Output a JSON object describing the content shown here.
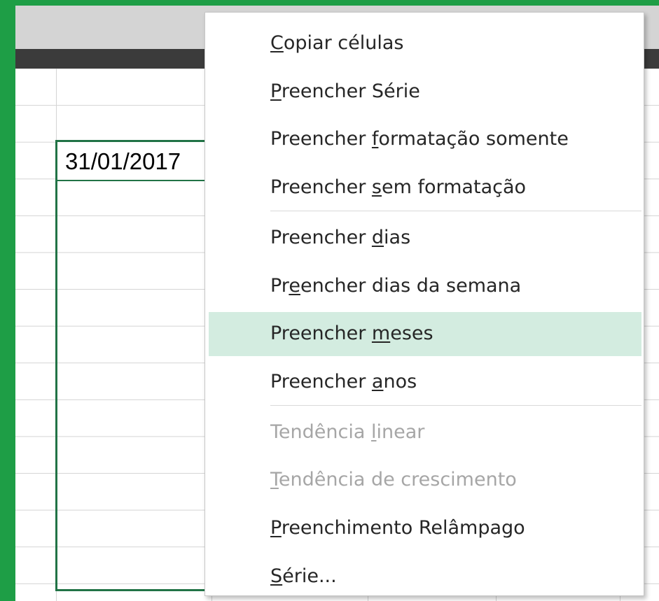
{
  "spreadsheet": {
    "active_cell_value": "31/01/2017"
  },
  "fill_menu": {
    "hovered_index": 6,
    "groups": [
      [
        {
          "pre": "",
          "key": "C",
          "post": "opiar células",
          "enabled": true
        },
        {
          "pre": "",
          "key": "P",
          "post": "reencher Série",
          "enabled": true
        },
        {
          "pre": "Preencher ",
          "key": "f",
          "post": "ormatação somente",
          "enabled": true
        },
        {
          "pre": "Preencher ",
          "key": "s",
          "post": "em formatação",
          "enabled": true
        }
      ],
      [
        {
          "pre": "Preencher ",
          "key": "d",
          "post": "ias",
          "enabled": true
        },
        {
          "pre": "Pr",
          "key": "e",
          "post": "encher dias da semana",
          "enabled": true
        },
        {
          "pre": "Preencher ",
          "key": "m",
          "post": "eses",
          "enabled": true
        },
        {
          "pre": "Preencher ",
          "key": "a",
          "post": "nos",
          "enabled": true
        }
      ],
      [
        {
          "pre": "Tendência ",
          "key": "l",
          "post": "inear",
          "enabled": false
        },
        {
          "pre": "",
          "key": "T",
          "post": "endência de crescimento",
          "enabled": false
        },
        {
          "pre": "",
          "key": "P",
          "post": "reenchimento Relâmpago",
          "enabled": true
        },
        {
          "pre": "",
          "key": "S",
          "post": "érie...",
          "enabled": true
        }
      ]
    ]
  }
}
